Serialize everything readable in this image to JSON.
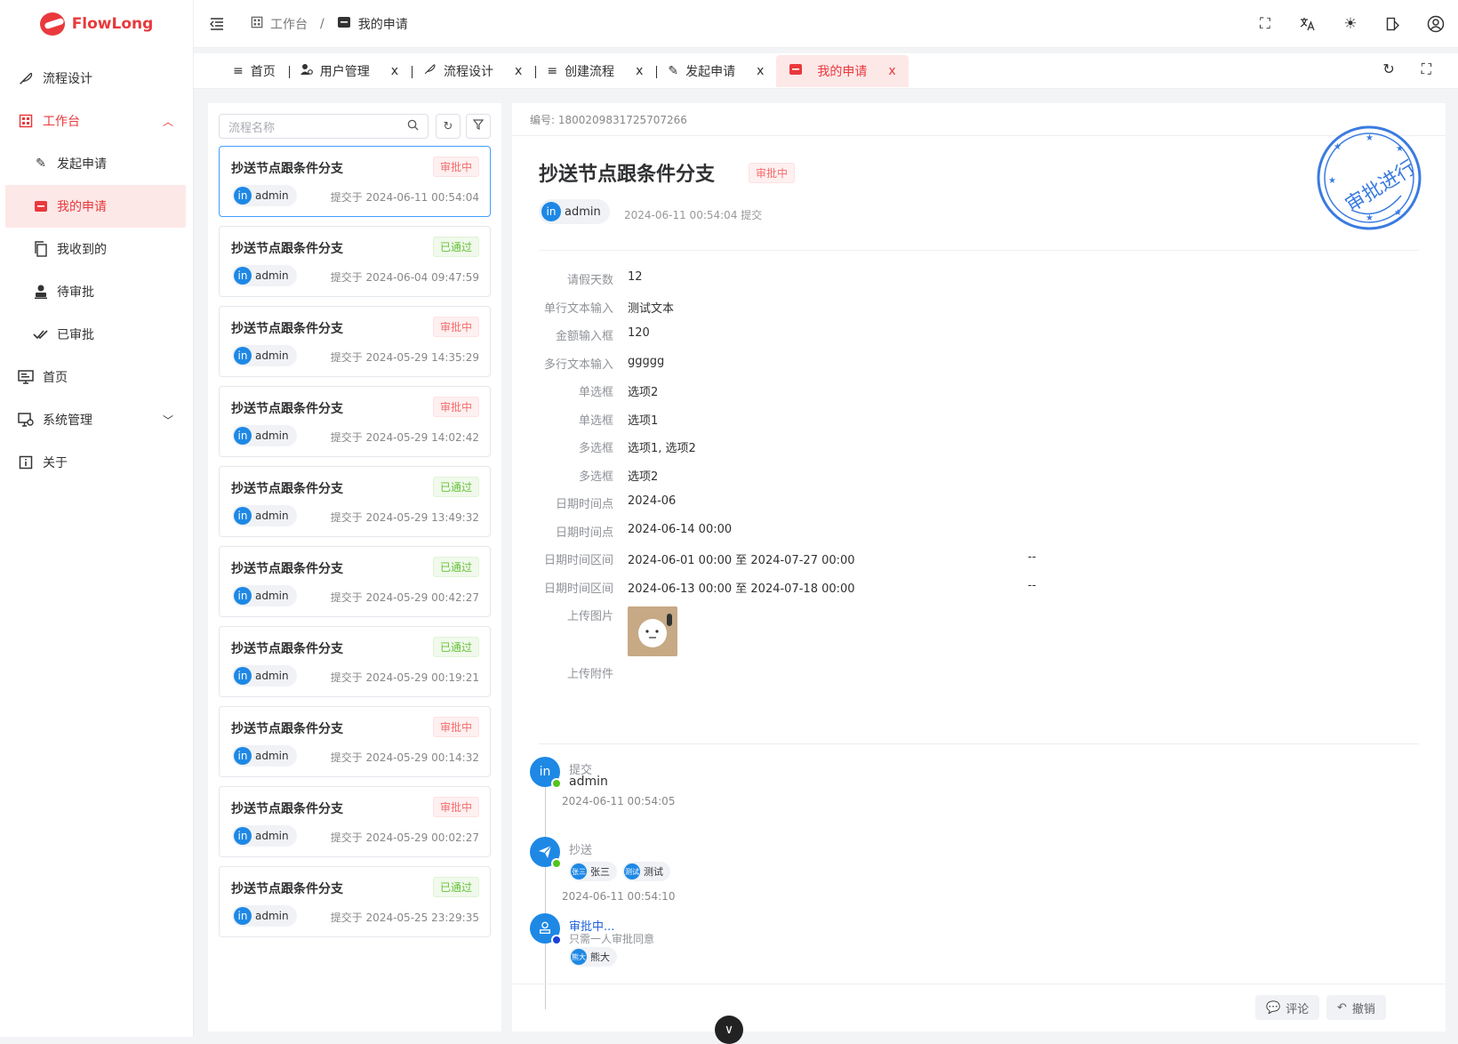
{
  "brand": {
    "name": "FlowLong",
    "accent": "#e9393c"
  },
  "sidebar": {
    "items": [
      {
        "label": "流程设计",
        "icon": "feather-icon"
      },
      {
        "label": "工作台",
        "icon": "grid-icon",
        "expanded": true,
        "children": [
          {
            "label": "发起申请",
            "icon": "pencil-icon"
          },
          {
            "label": "我的申请",
            "icon": "card-icon",
            "active": true
          },
          {
            "label": "我收到的",
            "icon": "copy-icon"
          },
          {
            "label": "待审批",
            "icon": "user-stamp-icon"
          },
          {
            "label": "已审批",
            "icon": "double-check-icon"
          }
        ]
      },
      {
        "label": "首页",
        "icon": "monitor-icon"
      },
      {
        "label": "系统管理",
        "icon": "settings-monitor-icon",
        "expanded": false
      },
      {
        "label": "关于",
        "icon": "info-icon"
      }
    ]
  },
  "breadcrumb": {
    "parent": "工作台",
    "sep": "/",
    "current": "我的申请"
  },
  "tabs": [
    {
      "label": "首页",
      "closable": false
    },
    {
      "label": "用户管理",
      "closable": true
    },
    {
      "label": "流程设计",
      "closable": true
    },
    {
      "label": "创建流程",
      "closable": true
    },
    {
      "label": "发起申请",
      "closable": true
    },
    {
      "label": "我的申请",
      "closable": true,
      "active": true
    }
  ],
  "list": {
    "search_placeholder": "流程名称",
    "items": [
      {
        "title": "抄送节点跟条件分支",
        "status": "审批中",
        "status_type": "red",
        "user": "admin",
        "time": "提交于 2024-06-11 00:54:04",
        "selected": true
      },
      {
        "title": "抄送节点跟条件分支",
        "status": "已通过",
        "status_type": "green",
        "user": "admin",
        "time": "提交于 2024-06-04 09:47:59"
      },
      {
        "title": "抄送节点跟条件分支",
        "status": "审批中",
        "status_type": "red",
        "user": "admin",
        "time": "提交于 2024-05-29 14:35:29"
      },
      {
        "title": "抄送节点跟条件分支",
        "status": "审批中",
        "status_type": "red",
        "user": "admin",
        "time": "提交于 2024-05-29 14:02:42"
      },
      {
        "title": "抄送节点跟条件分支",
        "status": "已通过",
        "status_type": "green",
        "user": "admin",
        "time": "提交于 2024-05-29 13:49:32"
      },
      {
        "title": "抄送节点跟条件分支",
        "status": "已通过",
        "status_type": "green",
        "user": "admin",
        "time": "提交于 2024-05-29 00:42:27"
      },
      {
        "title": "抄送节点跟条件分支",
        "status": "已通过",
        "status_type": "green",
        "user": "admin",
        "time": "提交于 2024-05-29 00:19:21"
      },
      {
        "title": "抄送节点跟条件分支",
        "status": "审批中",
        "status_type": "red",
        "user": "admin",
        "time": "提交于 2024-05-29 00:14:32"
      },
      {
        "title": "抄送节点跟条件分支",
        "status": "审批中",
        "status_type": "red",
        "user": "admin",
        "time": "提交于 2024-05-29 00:02:27"
      },
      {
        "title": "抄送节点跟条件分支",
        "status": "已通过",
        "status_type": "green",
        "user": "admin",
        "time": "提交于 2024-05-25 23:29:35"
      }
    ]
  },
  "detail": {
    "number_label": "编号:",
    "number": "1800209831725707266",
    "title": "抄送节点跟条件分支",
    "status": "审批中",
    "user": "admin",
    "submit_time": "2024-06-11 00:54:04 提交",
    "stamp_text": "审批进行",
    "fields": [
      {
        "label": "请假天数",
        "value": "12"
      },
      {
        "label": "单行文本输入",
        "value": "测试文本"
      },
      {
        "label": "金额输入框",
        "value": "120"
      },
      {
        "label": "多行文本输入",
        "value": "ggggg"
      },
      {
        "label": "单选框",
        "value": "选项2"
      },
      {
        "label": "单选框",
        "value": "选项1"
      },
      {
        "label": "多选框",
        "value": "选项1, 选项2"
      },
      {
        "label": "多选框",
        "value": "选项2"
      },
      {
        "label": "日期时间点",
        "value": "2024-06"
      },
      {
        "label": "日期时间点",
        "value": "2024-06-14 00:00"
      },
      {
        "label": "日期时间区间",
        "value": "2024-06-01 00:00 至 2024-07-27 00:00",
        "extra": "--"
      },
      {
        "label": "日期时间区间",
        "value": "2024-06-13 00:00 至 2024-07-18 00:00",
        "extra": "--"
      },
      {
        "label": "上传图片",
        "value": ""
      },
      {
        "label": "上传附件",
        "value": ""
      }
    ],
    "timeline": [
      {
        "title": "提交",
        "user": "admin",
        "time": "2024-06-11 00:54:05"
      },
      {
        "title": "抄送",
        "users": [
          {
            "short": "张三",
            "name": "张三"
          },
          {
            "short": "测试",
            "name": "测试"
          }
        ],
        "time": "2024-06-11 00:54:10"
      },
      {
        "title": "审批中...",
        "subtitle": "只需一人审批同意",
        "users": [
          {
            "short": "熊大",
            "name": "熊大"
          }
        ]
      }
    ],
    "actions": {
      "comment": "评论",
      "revoke": "撤销"
    }
  },
  "avatar_text": "in"
}
